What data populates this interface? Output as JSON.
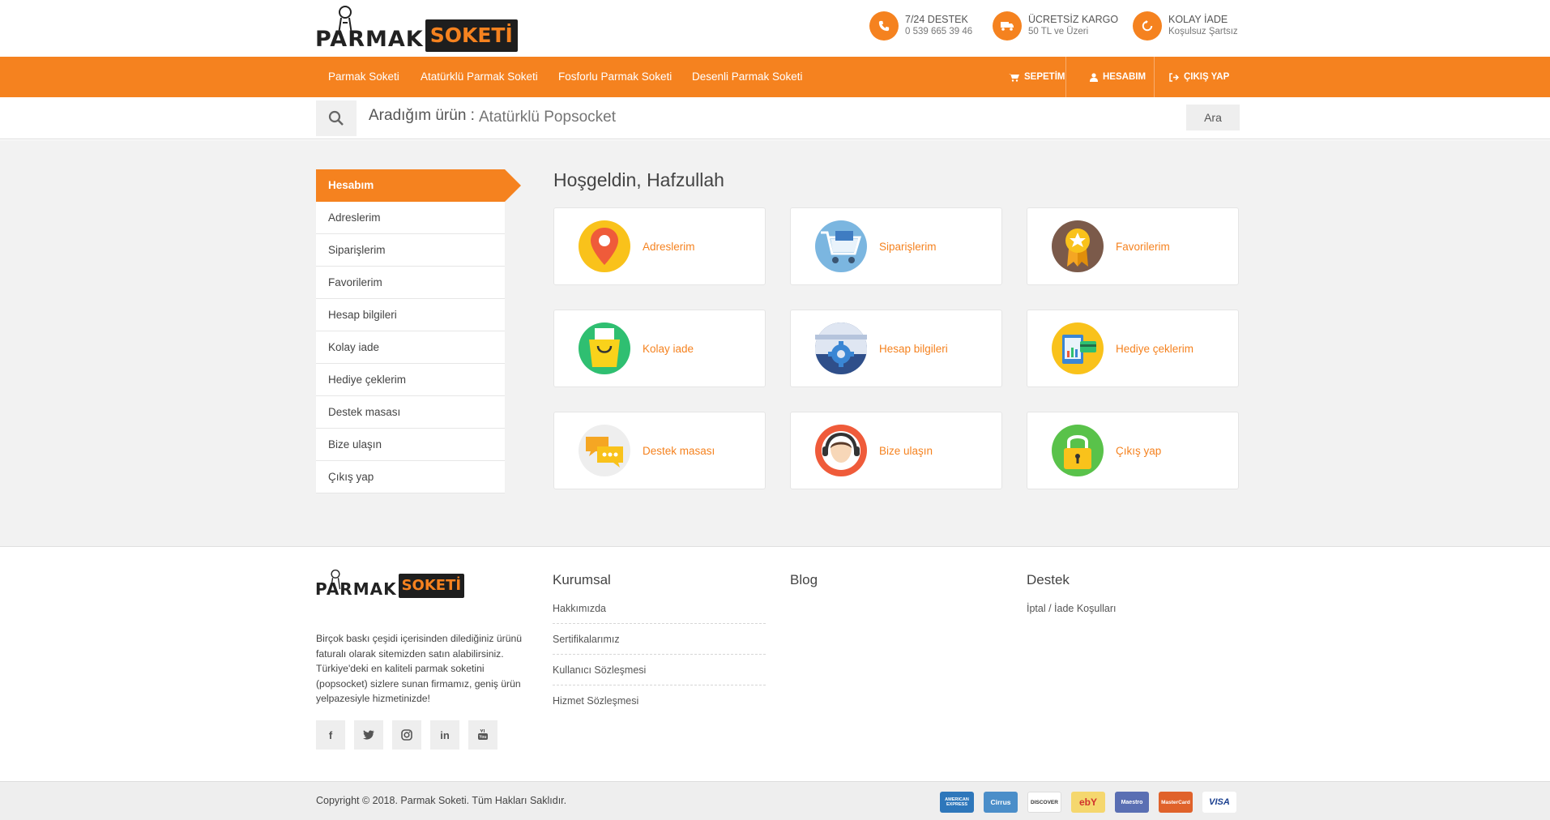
{
  "header": {
    "logo_left": "PARMAK",
    "logo_right": "SOKETİ",
    "info": [
      {
        "icon": "phone-icon",
        "title": "7/24 DESTEK",
        "sub": "0 539 665 39 46"
      },
      {
        "icon": "truck-icon",
        "title": "ÜCRETSİZ KARGO",
        "sub": "50 TL ve Üzeri"
      },
      {
        "icon": "refresh-icon",
        "title": "KOLAY İADE",
        "sub": "Koşulsuz Şartsız"
      }
    ]
  },
  "nav": {
    "links": [
      "Parmak Soketi",
      "Atatürklü Parmak Soketi",
      "Fosforlu Parmak Soketi",
      "Desenli Parmak Soketi"
    ],
    "cart": "SEPETİM",
    "account": "HESABIM",
    "logout": "ÇIKIŞ YAP"
  },
  "search": {
    "label": "Aradığım ürün :",
    "placeholder": "Atatürklü Popsocket",
    "button": "Ara"
  },
  "sidebar": {
    "active": "Hesabım",
    "items": [
      "Adreslerim",
      "Siparişlerim",
      "Favorilerim",
      "Hesap bilgileri",
      "Kolay iade",
      "Hediye çeklerim",
      "Destek masası",
      "Bize ulaşın",
      "Çıkış yap"
    ]
  },
  "main": {
    "welcome": "Hoşgeldin, Hafzullah",
    "cards": [
      {
        "label": "Adreslerim",
        "icon": "map-pin-icon"
      },
      {
        "label": "Siparişlerim",
        "icon": "shopping-cart-icon"
      },
      {
        "label": "Favorilerim",
        "icon": "award-badge-icon"
      },
      {
        "label": "Kolay iade",
        "icon": "shopping-bag-icon"
      },
      {
        "label": "Hesap bilgileri",
        "icon": "settings-gear-icon"
      },
      {
        "label": "Hediye çeklerim",
        "icon": "gift-voucher-icon"
      },
      {
        "label": "Destek masası",
        "icon": "chat-bubbles-icon"
      },
      {
        "label": "Bize ulaşın",
        "icon": "headset-support-icon"
      },
      {
        "label": "Çıkış yap",
        "icon": "padlock-icon"
      }
    ]
  },
  "footer": {
    "description": "Birçok baskı çeşidi içerisinden dilediğiniz ürünü faturalı olarak sitemizden satın alabilirsiniz. Türkiye'deki en kaliteli parmak soketini (popsocket) sizlere sunan firmamız, geniş ürün yelpazesiyle hizmetinizde!",
    "social": [
      "f",
      "t",
      "ig",
      "in",
      "yt"
    ],
    "kurumsal_title": "Kurumsal",
    "kurumsal_links": [
      "Hakkımızda",
      "Sertifikalarımız",
      "Kullanıcı Sözleşmesi",
      "Hizmet Sözleşmesi"
    ],
    "blog_title": "Blog",
    "destek_title": "Destek",
    "destek_links": [
      "İptal / İade Koşulları"
    ],
    "copyright": "Copyright © 2018. Parmak Soketi. Tüm Hakları Saklıdır.",
    "payment_cards": [
      "AMERICAN EXPRESS",
      "Cirrus",
      "DISCOVER",
      "ebY",
      "Maestro",
      "MasterCard",
      "VISA"
    ]
  },
  "colors": {
    "accent": "#f5821f",
    "background": "#f2f2f2"
  }
}
